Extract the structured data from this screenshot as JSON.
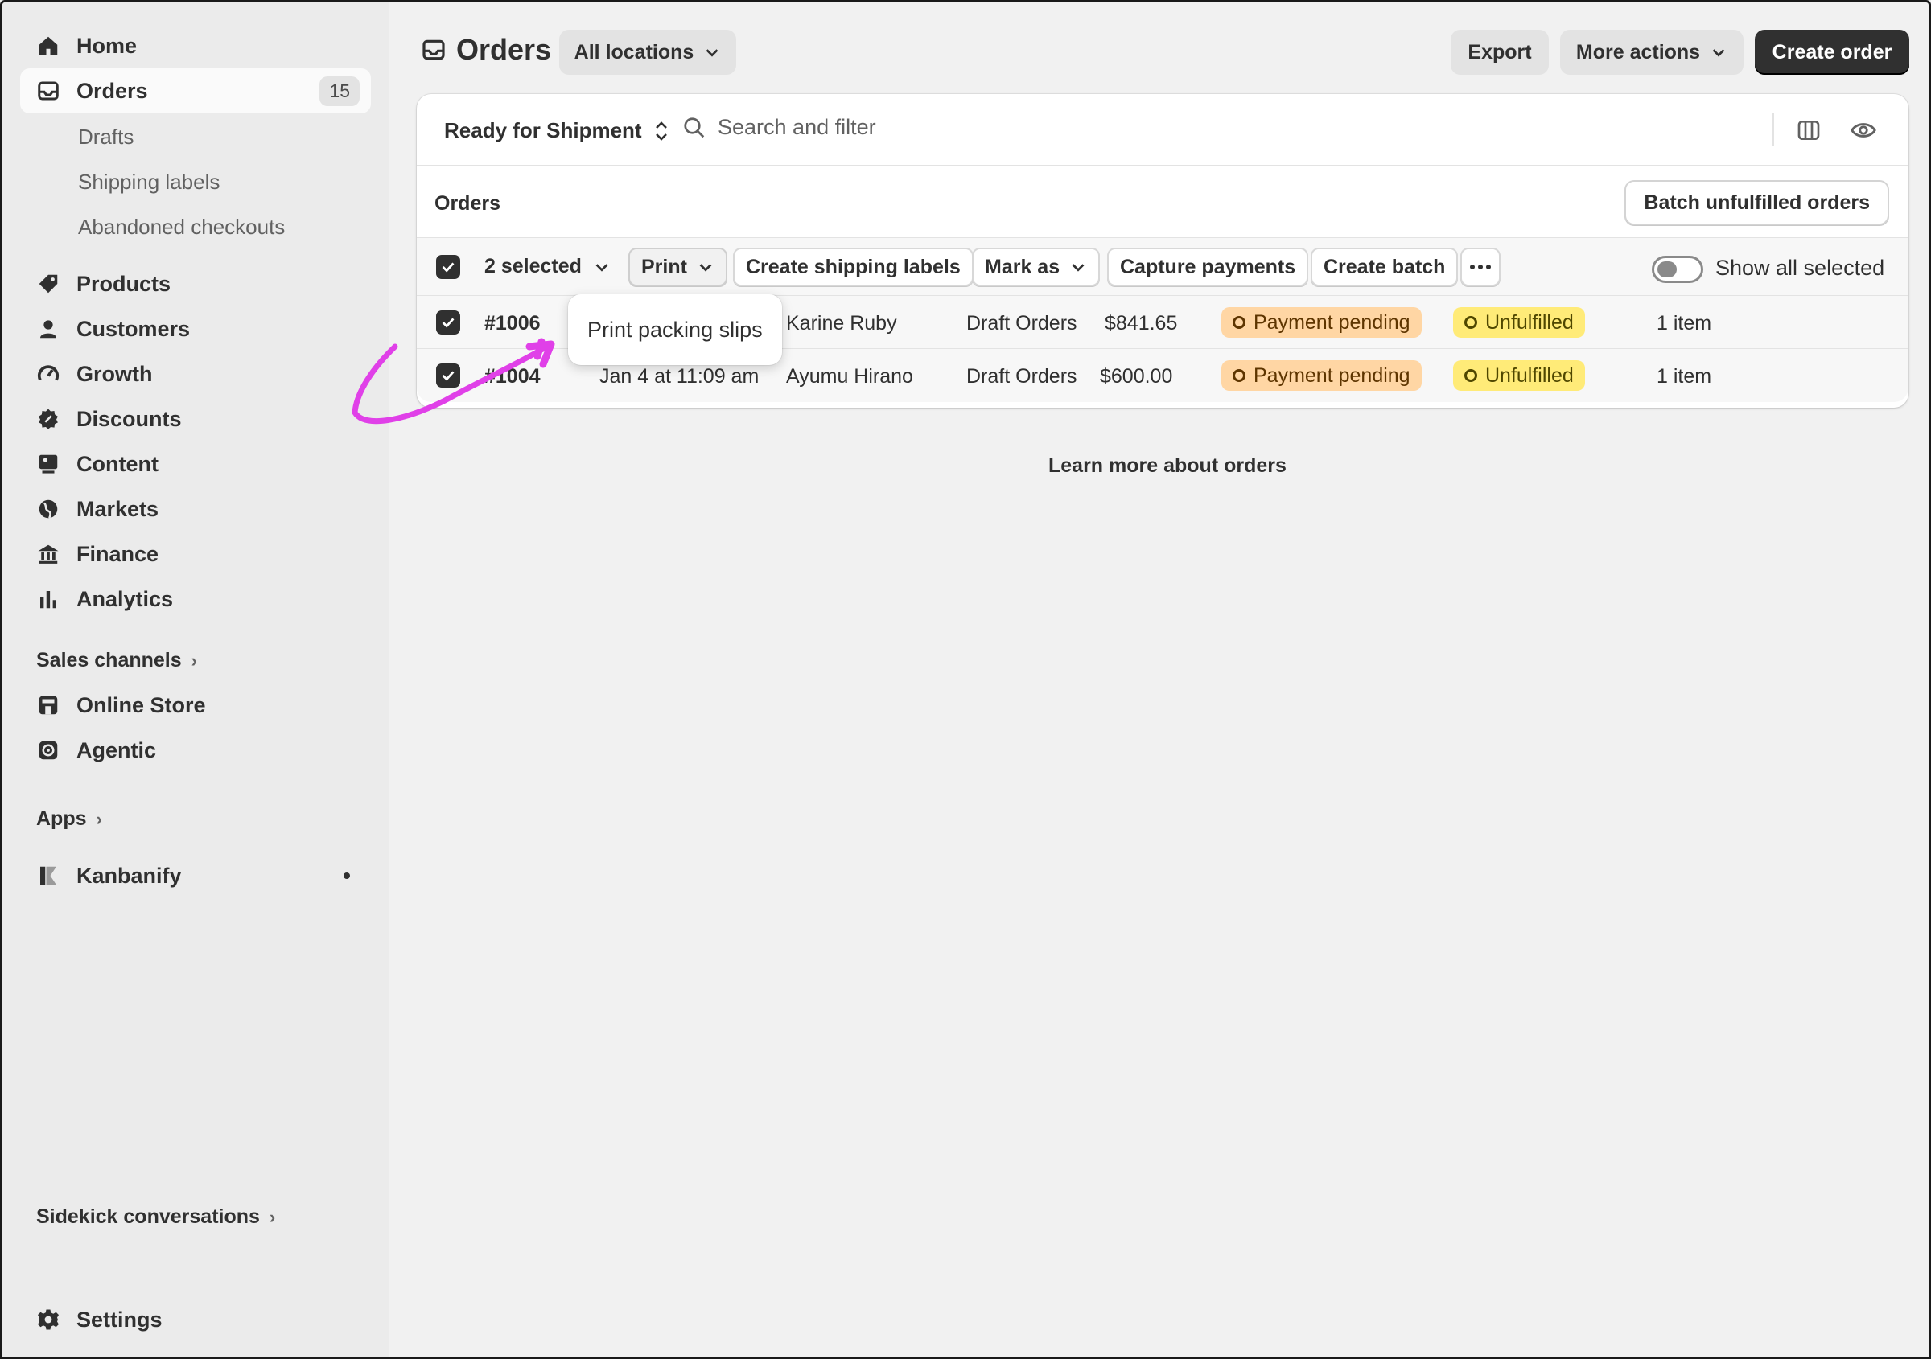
{
  "sidebar": {
    "main": [
      {
        "label": "Home",
        "icon": "home-icon"
      },
      {
        "label": "Orders",
        "icon": "inbox-icon",
        "badge": "15"
      },
      {
        "label": "Products",
        "icon": "tag-icon"
      },
      {
        "label": "Customers",
        "icon": "person-icon"
      },
      {
        "label": "Growth",
        "icon": "gauge-icon"
      },
      {
        "label": "Discounts",
        "icon": "discount-icon"
      },
      {
        "label": "Content",
        "icon": "image-icon"
      },
      {
        "label": "Markets",
        "icon": "globe-icon"
      },
      {
        "label": "Finance",
        "icon": "bank-icon"
      },
      {
        "label": "Analytics",
        "icon": "bar-chart-icon"
      }
    ],
    "orders_sub": [
      "Drafts",
      "Shipping labels",
      "Abandoned checkouts"
    ],
    "sales_channels_label": "Sales channels",
    "channels": [
      {
        "label": "Online Store",
        "icon": "store-icon"
      },
      {
        "label": "Agentic",
        "icon": "robot-icon"
      }
    ],
    "apps_label": "Apps",
    "apps": [
      {
        "label": "Kanbanify",
        "icon": "kanbanify-logo-icon"
      }
    ],
    "sidekick_label": "Sidekick conversations",
    "settings_label": "Settings"
  },
  "header": {
    "title": "Orders",
    "location_select": "All locations",
    "export_label": "Export",
    "more_actions_label": "More actions",
    "create_order_label": "Create order"
  },
  "filterbar": {
    "view": "Ready for Shipment",
    "search_placeholder": "Search and filter"
  },
  "orders_section": {
    "label": "Orders",
    "batch_button": "Batch unfulfilled orders"
  },
  "bulk_actions": {
    "selected": "2 selected",
    "print": "Print",
    "create_shipping_labels": "Create shipping labels",
    "mark_as": "Mark as",
    "capture_payments": "Capture payments",
    "create_batch": "Create batch",
    "show_all_selected": "Show all selected"
  },
  "rows": [
    {
      "order": "#1006",
      "date": "",
      "customer": "Karine Ruby",
      "channel": "Draft Orders",
      "total": "$841.65",
      "payment": "Payment pending",
      "fulfillment": "Unfulfilled",
      "items": "1 item"
    },
    {
      "order": "#1004",
      "date": "Jan 4 at 11:09 am",
      "customer": "Ayumu Hirano",
      "channel": "Draft Orders",
      "total": "$600.00",
      "payment": "Payment pending",
      "fulfillment": "Unfulfilled",
      "items": "1 item"
    }
  ],
  "popover": {
    "label": "Print packing slips"
  },
  "learn_more": "Learn more about orders",
  "colors": {
    "payment_pending_bg": "#ffd6a4",
    "unfulfilled_bg": "#ffeb78",
    "annotation_arrow": "#e040e8"
  }
}
